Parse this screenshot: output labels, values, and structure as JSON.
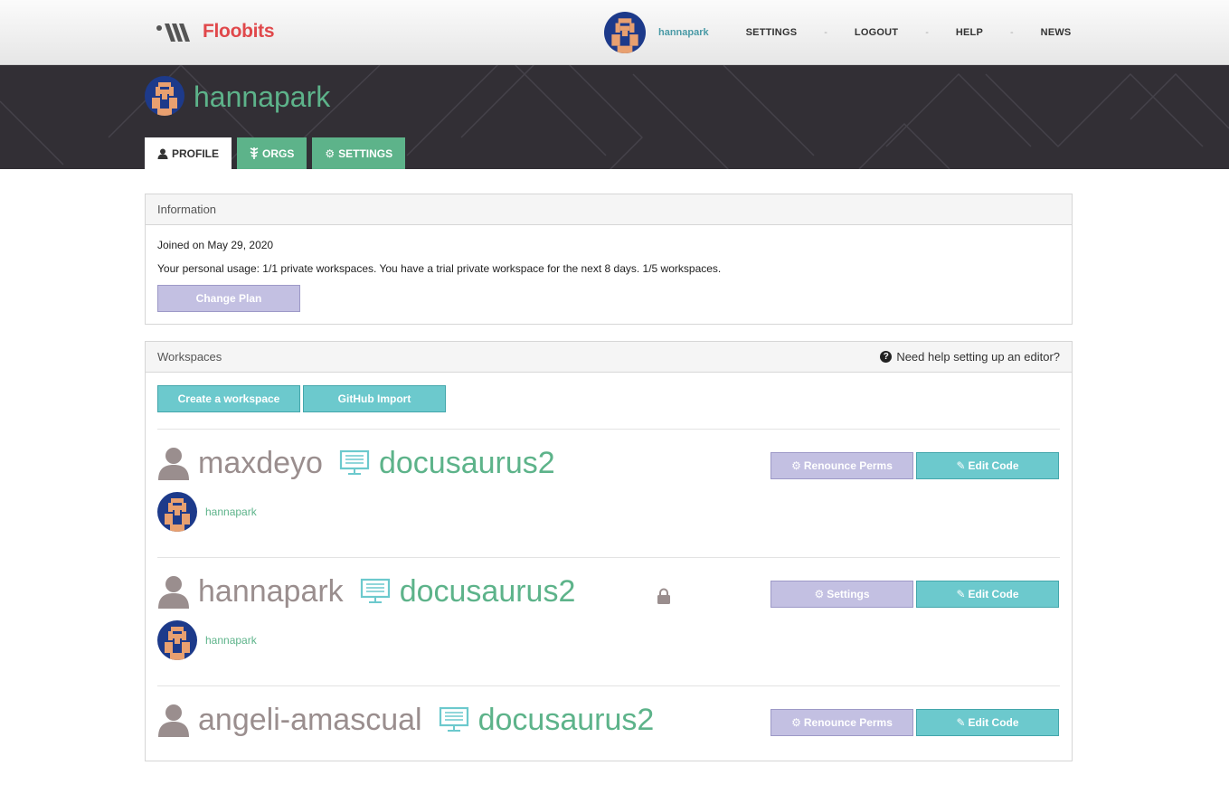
{
  "nav": {
    "brand": "Floobits",
    "username": "hannapark",
    "links": [
      "SETTINGS",
      "LOGOUT",
      "HELP",
      "NEWS"
    ],
    "separator": "-"
  },
  "header": {
    "title": "hannapark",
    "tabs": [
      {
        "label": "PROFILE",
        "icon": "user-icon"
      },
      {
        "label": "ORGS",
        "icon": "orgs-icon"
      },
      {
        "label": "SETTINGS",
        "icon": "gear-icon"
      }
    ],
    "active_tab": "PROFILE"
  },
  "information": {
    "heading": "Information",
    "joined": "Joined on May 29, 2020",
    "usage": "Your personal usage: 1/1 private workspaces. You have a trial private workspace for the next 8 days. 1/5 workspaces.",
    "change_plan_label": "Change Plan"
  },
  "workspaces": {
    "heading": "Workspaces",
    "help_text": "Need help setting up an editor?",
    "create_label": "Create a workspace",
    "github_label": "GitHub Import",
    "items": [
      {
        "owner": "maxdeyo",
        "name": "docusaurus2",
        "member": "hannapark",
        "private": false,
        "action": "Renounce Perms",
        "edit": "Edit Code"
      },
      {
        "owner": "hannapark",
        "name": "docusaurus2",
        "member": "hannapark",
        "private": true,
        "action": "Settings",
        "edit": "Edit Code"
      },
      {
        "owner": "angeli-amascual",
        "name": "docusaurus2",
        "private": false,
        "action": "Renounce Perms",
        "edit": "Edit Code"
      }
    ]
  },
  "colors": {
    "brand_red": "#e0484b",
    "accent_green": "#5db38a",
    "teal_button": "#6cc9cd",
    "purple_button": "#c3c0e2",
    "banner_dark": "#322f35",
    "owner_gray": "#9a8e8e"
  }
}
